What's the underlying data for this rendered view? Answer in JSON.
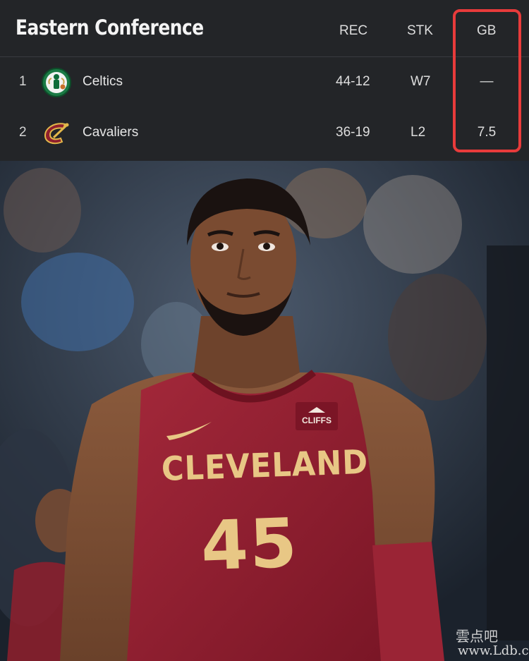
{
  "standings": {
    "title": "Eastern Conference",
    "columns": {
      "rec": "REC",
      "stk": "STK",
      "gb": "GB"
    },
    "rows": [
      {
        "rank": "1",
        "team": "Celtics",
        "logo": "celtics-logo",
        "rec": "44-12",
        "stk": "W7",
        "gb": "—"
      },
      {
        "rank": "2",
        "team": "Cavaliers",
        "logo": "cavaliers-logo",
        "rec": "36-19",
        "stk": "L2",
        "gb": "7.5"
      }
    ],
    "highlight_color": "#e83b3b"
  },
  "photo": {
    "jersey_wordmark": "CLEVELAND",
    "jersey_number": "45",
    "sponsor_patch": "CLIFFS",
    "jersey_color": "#8f1f2d",
    "lettering_color": "#e8c785"
  },
  "watermark": {
    "chinese": "雲点吧",
    "url": "www.Ldb.cc"
  }
}
